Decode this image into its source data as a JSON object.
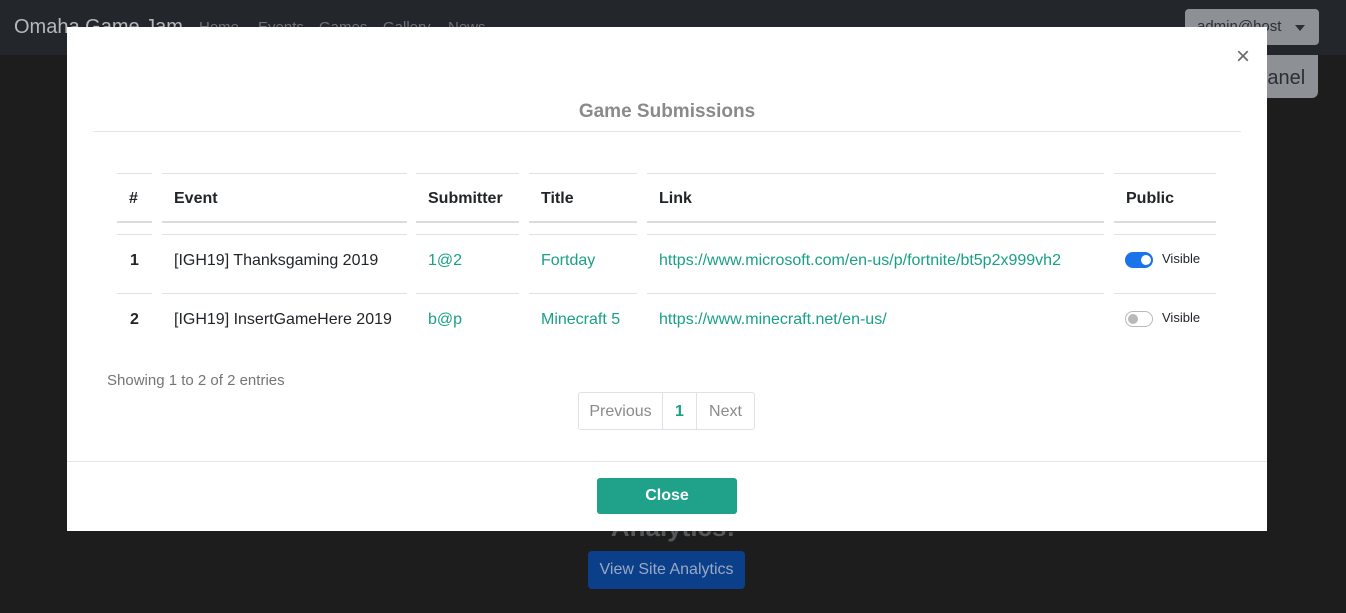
{
  "background": {
    "brand": "Omaha Game Jam",
    "nav": [
      "Home",
      "Events",
      "Games",
      "Gallery",
      "News"
    ],
    "user_menu": "admin@host",
    "panel_button": "Panel",
    "heading": "Analytics:",
    "analytics_button": "View Site Analytics"
  },
  "modal": {
    "title": "Game Submissions",
    "close_x": "×",
    "table": {
      "headers": {
        "num": "#",
        "event": "Event",
        "submitter": "Submitter",
        "title": "Title",
        "link": "Link",
        "public": "Public"
      },
      "rows": [
        {
          "num": "1",
          "event": "[IGH19] Thanksgaming 2019",
          "submitter": "1@2",
          "title": "Fortday",
          "link": "https://www.microsoft.com/en-us/p/fortnite/bt5p2x999vh2",
          "public_on": true,
          "public_label": "Visible"
        },
        {
          "num": "2",
          "event": "[IGH19] InsertGameHere 2019",
          "submitter": "b@p",
          "title": "Minecraft 5",
          "link": "https://www.minecraft.net/en-us/",
          "public_on": false,
          "public_label": "Visible"
        }
      ]
    },
    "showing_text": "Showing 1 to 2 of 2 entries",
    "pagination": {
      "previous": "Previous",
      "current": "1",
      "next": "Next"
    },
    "close_button": "Close"
  },
  "colors": {
    "accent": "#1fa289",
    "link": "#1aa087",
    "toggle_on": "#1a73e8"
  }
}
